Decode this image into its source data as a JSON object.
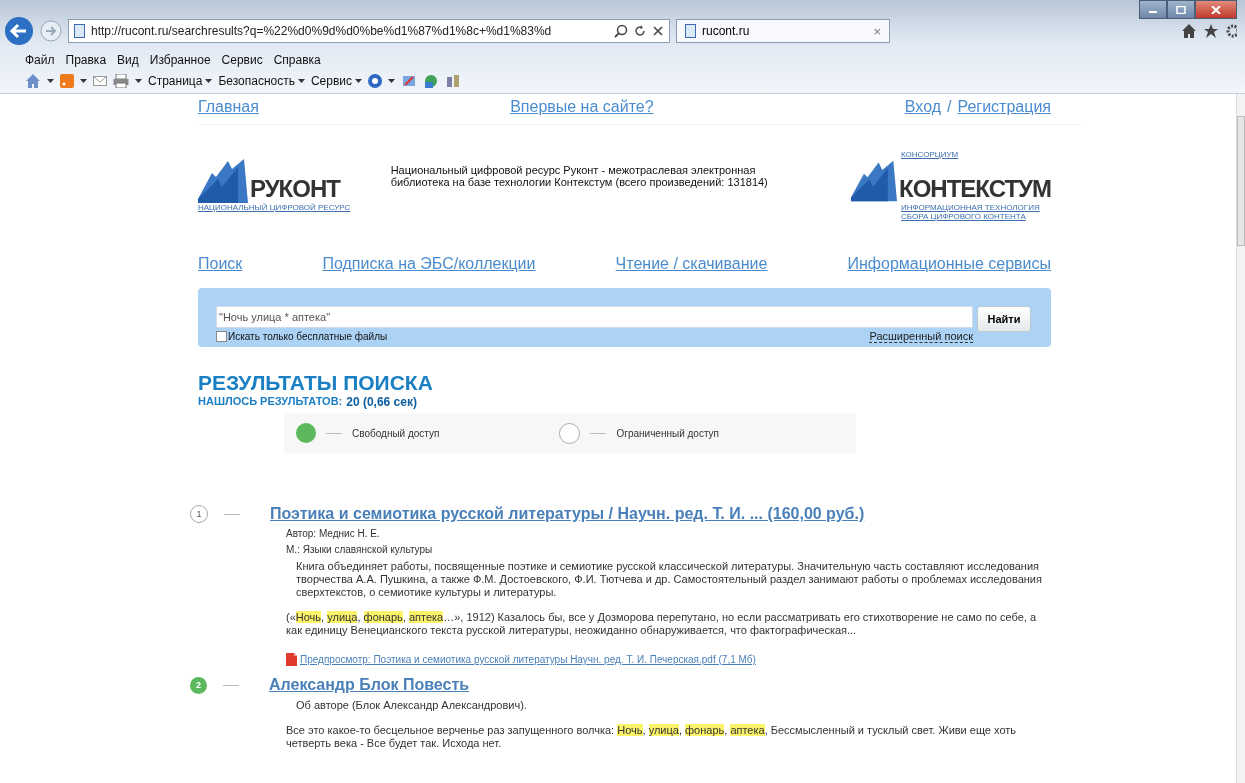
{
  "browser": {
    "address": "http://rucont.ru/searchresults?q=%22%d0%9d%d0%be%d1%87%d1%8c+%d1%83%d",
    "tab": {
      "label": "rucont.ru",
      "close": "×"
    },
    "menu": [
      "Файл",
      "Правка",
      "Вид",
      "Избранное",
      "Сервис",
      "Справка"
    ],
    "toolbar": [
      "Страница",
      "Безопасность",
      "Сервис"
    ]
  },
  "top_nav": {
    "home": "Главная",
    "first_visit": "Впервые на сайте?",
    "login": "Вход",
    "separator": "/",
    "register": "Регистрация"
  },
  "header": {
    "logo_left": {
      "name": "РУКОНТ",
      "tagline": "НАЦИОНАЛЬНЫЙ ЦИФРОВОЙ РЕСУРС"
    },
    "description": "Национальный цифровой ресурс Руконт - межотраслевая электронная библиотека на базе технологии Контекстум (всего произведений: 131814)",
    "logo_right": {
      "overline": "КОНСОРЦИУМ",
      "name": "КОНТЕКСТУМ",
      "tagline": "ИНФОРМАЦИОННАЯ ТЕХНОЛОГИЯ СБОРА ЦИФРОВОГО КОНТЕНТА"
    }
  },
  "main_nav": [
    "Поиск",
    "Подписка на ЭБС/коллекции",
    "Чтение / скачивание",
    "Информационные сервисы"
  ],
  "search": {
    "value": "\"Ночь улица * аптека\"",
    "button": "Найти",
    "free_only": {
      "label": "Искать только бесплатные файлы",
      "checked": false
    },
    "advanced": "Расширенный поиск"
  },
  "results": {
    "title": "РЕЗУЛЬТАТЫ ПОИСКА",
    "count_label": "НАШЛОСЬ РЕЗУЛЬТАТОВ:",
    "count": "20 (0,66 сек)",
    "legend": [
      {
        "free_access": true,
        "label": "Свободный доступ"
      },
      {
        "free_access": false,
        "label": "Ограниченный доступ"
      }
    ],
    "items": [
      {
        "number": "1",
        "free_access": false,
        "title": "Поэтика и семиотика русской литературы / Научн. ред. Т. И. ... (160,00 руб.)",
        "lines": [
          "Автор: Меднис Н. Е.",
          "М.: Языки славянской культуры"
        ],
        "abstract": "Книга объединяет работы, посвященные поэтике и семиотике русской классической литературы. Значительную часть составляют исследования творчества А.А. Пушкина, а также Ф.М. Достоевского, Ф.И. Тютчева и др. Самостоятельный раздел занимают работы о проблемах исследования сверхтекстов, о семиотике культуры и литературы.",
        "snippet": [
          {
            "text": "(«",
            "highlight": false
          },
          {
            "text": "Ночь",
            "highlight": true
          },
          {
            "text": ", ",
            "highlight": false
          },
          {
            "text": "улица",
            "highlight": true
          },
          {
            "text": ", ",
            "highlight": false
          },
          {
            "text": "фонарь",
            "highlight": true
          },
          {
            "text": ", ",
            "highlight": false
          },
          {
            "text": "аптека",
            "highlight": true
          },
          {
            "text": "…», 1912) Казалось бы, все у Дозморова перепутано, но если рассматривать его стихотворение не само по себе, а как единицу Венецианского текста русской литературы, неожиданно обнаруживается, что фактографическая...",
            "highlight": false
          }
        ],
        "preview": "Предпросмотр: Поэтика и семиотика русской литературы Научн. ред. Т. И. Печерская.pdf (7,1 Мб)"
      },
      {
        "number": "2",
        "free_access": true,
        "title": "Александр Блок Повесть",
        "abstract": "Об авторе (Блок Александр Александрович).",
        "snippet": [
          {
            "text": "Все это какое-то бесцельное верченье раз запущенного волчка: ",
            "highlight": false
          },
          {
            "text": "Ночь",
            "highlight": true
          },
          {
            "text": ", ",
            "highlight": false
          },
          {
            "text": "улица",
            "highlight": true
          },
          {
            "text": ", ",
            "highlight": false
          },
          {
            "text": "фонарь",
            "highlight": true
          },
          {
            "text": ", ",
            "highlight": false
          },
          {
            "text": "аптека",
            "highlight": true
          },
          {
            "text": ", Бессмысленный и тусклый свет. Живи еще хоть четверть века - Все будет так. Исхода нет.",
            "highlight": false
          }
        ]
      }
    ]
  }
}
